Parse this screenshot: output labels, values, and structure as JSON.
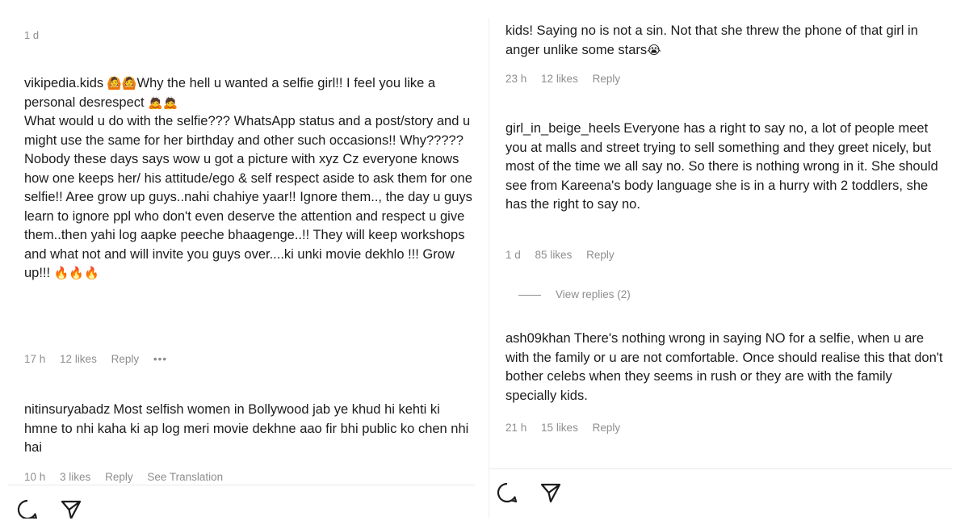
{
  "left": {
    "top_timestamp": "1 d",
    "comments": [
      {
        "username": "vikipedia.kids",
        "emojis_start": "🙆🙆",
        "text": "Why the hell u wanted a selfie girl!! I feel you like a personal desrespect",
        "emojis_mid": "🙇🙇",
        "text2": "What would u do with the selfie??? WhatsApp status and a post/story and u might use the same for her birthday and other such occasions!! Why?????",
        "text3": "Nobody these days says wow u got a picture with xyz Cz everyone knows how one keeps her/ his attitude/ego & self respect aside to ask them for one selfie!! Aree grow up guys..nahi chahiye yaar!! Ignore them.., the day u guys learn to ignore ppl who don't even deserve the attention and respect u give them..then yahi log aapke peeche bhaagenge..!! They will keep workshops and what not and will invite you guys over....ki unki movie dekhlo !!! Grow up!!!",
        "emojis_end": "🔥🔥🔥",
        "time": "17 h",
        "likes": "12 likes",
        "reply": "Reply",
        "more": "•••"
      },
      {
        "username": "nitinsuryabadz",
        "text": "Most selfish women in Bollywood jab ye khud hi kehti ki hmne to nhi kaha ki ap log meri movie dekhne aao fir bhi public ko chen nhi hai",
        "time": "10 h",
        "likes": "3 likes",
        "reply": "Reply",
        "translate": "See Translation"
      }
    ]
  },
  "right": {
    "comments": [
      {
        "text": "kids! Saying no is not a sin. Not that she threw the phone of that girl in anger unlike some stars",
        "emoji": "😭",
        "time": "23 h",
        "likes": "12 likes",
        "reply": "Reply"
      },
      {
        "username": "girl_in_beige_heels",
        "text": "Everyone has a right to say no, a lot of people meet you at malls and street trying to sell something and they greet nicely, but most of the time we all say no. So there is nothing wrong in it. She should see from Kareena's body language she is in a hurry with 2 toddlers, she has the right to say no.",
        "time": "1 d",
        "likes": "85 likes",
        "reply": "Reply",
        "view_replies": "View replies (2)"
      },
      {
        "username": "ash09khan",
        "text": "There's nothing wrong in saying NO for a selfie, when u are with the family or u are not comfortable. Once should realise this that don't bother celebs when they seems in rush or they are with the family specially kids.",
        "time": "21 h",
        "likes": "15 likes",
        "reply": "Reply"
      }
    ]
  },
  "icons": {
    "comment": "comment-icon",
    "share": "share-icon"
  }
}
